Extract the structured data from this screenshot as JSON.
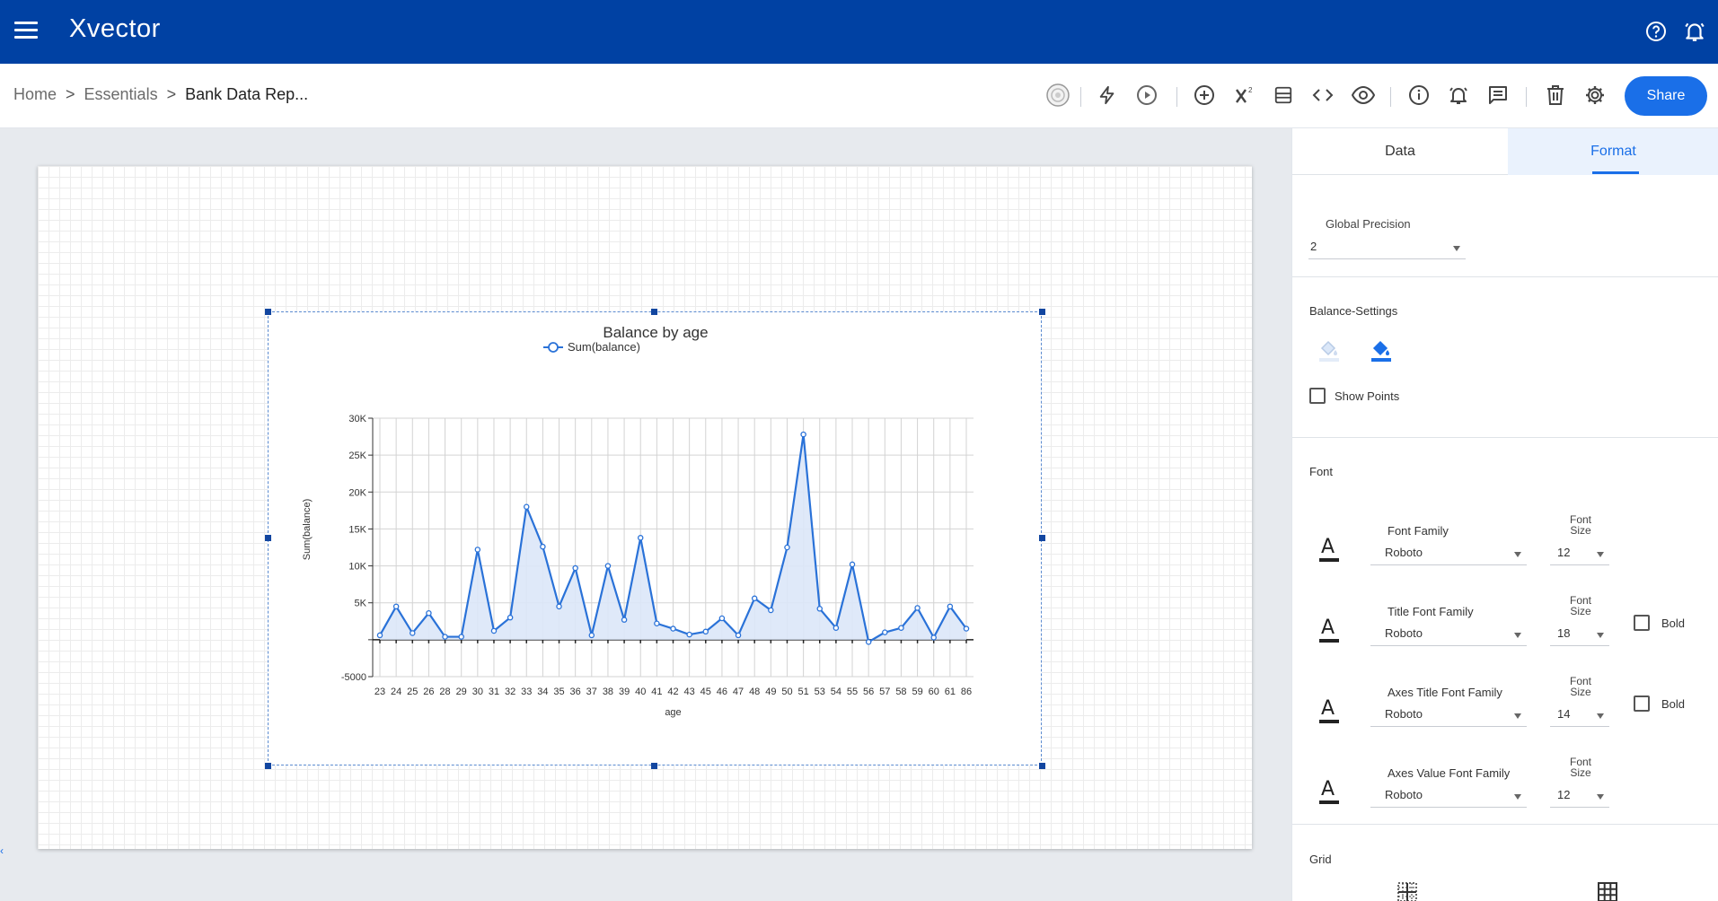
{
  "app": {
    "logo_text": "Xvector"
  },
  "header": {
    "icons": [
      "help-icon",
      "notification-bell-icon"
    ]
  },
  "breadcrumb": {
    "home": "Home",
    "separator": ">",
    "workspace": "Essentials",
    "current": "Bank Data Rep..."
  },
  "toolbar": {
    "icons": [
      "avatar-icon",
      "lightning-icon",
      "play-icon",
      "add-circle-icon",
      "superscript-x-icon",
      "panel-icon",
      "code-icon",
      "eye-icon",
      "info-icon",
      "alarm-icon",
      "comment-icon",
      "trash-icon",
      "gear-icon"
    ],
    "share_label": "Share"
  },
  "panel": {
    "tabs": [
      {
        "label": "Data",
        "active": false
      },
      {
        "label": "Format",
        "active": true
      }
    ],
    "global_precision": {
      "label": "Global Precision",
      "value": "2"
    },
    "series_settings": {
      "title": "Balance-Settings",
      "show_points_label": "Show Points",
      "show_points_checked": false
    },
    "font": {
      "title": "Font",
      "font_size_label": "Font Size",
      "bold_label": "Bold",
      "rows": [
        {
          "label": "Font Family",
          "family": "Roboto",
          "size": "12",
          "has_bold": false
        },
        {
          "label": "Title Font Family",
          "family": "Roboto",
          "size": "18",
          "has_bold": true
        },
        {
          "label": "Axes Title Font Family",
          "family": "Roboto",
          "size": "14",
          "has_bold": true
        },
        {
          "label": "Axes Value Font Family",
          "family": "Roboto",
          "size": "12",
          "has_bold": false
        }
      ]
    },
    "grid": {
      "title": "Grid"
    }
  },
  "colors": {
    "topbar": "#0041a3",
    "accent": "#1a6fe8",
    "series_line": "#2a72d8",
    "series_fill": "#dbe7f8"
  },
  "chart_data": {
    "type": "area",
    "title": "Balance by age",
    "xlabel": "age",
    "ylabel": "Sum(balance)",
    "legend": "top-center",
    "grid": true,
    "ylim": [
      -5000,
      30000
    ],
    "yticks": [
      -5000,
      0,
      5000,
      10000,
      15000,
      20000,
      25000,
      30000
    ],
    "ytick_labels": [
      "-5000",
      "",
      "5K",
      "10K",
      "15K",
      "20K",
      "25K",
      "30K"
    ],
    "categories": [
      "23",
      "24",
      "25",
      "26",
      "28",
      "29",
      "30",
      "31",
      "32",
      "33",
      "34",
      "35",
      "36",
      "37",
      "38",
      "39",
      "40",
      "41",
      "42",
      "43",
      "45",
      "46",
      "47",
      "48",
      "49",
      "50",
      "51",
      "53",
      "54",
      "55",
      "56",
      "57",
      "58",
      "59",
      "60",
      "61",
      "86"
    ],
    "series": [
      {
        "name": "Sum(balance)",
        "values": [
          600,
          4500,
          900,
          3600,
          400,
          400,
          12200,
          1200,
          3000,
          18000,
          12600,
          4500,
          9700,
          600,
          10000,
          2700,
          13800,
          2200,
          1500,
          700,
          1100,
          2900,
          600,
          5600,
          4000,
          12500,
          27800,
          4200,
          1600,
          10200,
          -300,
          1000,
          1600,
          4300,
          300,
          4500,
          1500
        ]
      }
    ]
  }
}
